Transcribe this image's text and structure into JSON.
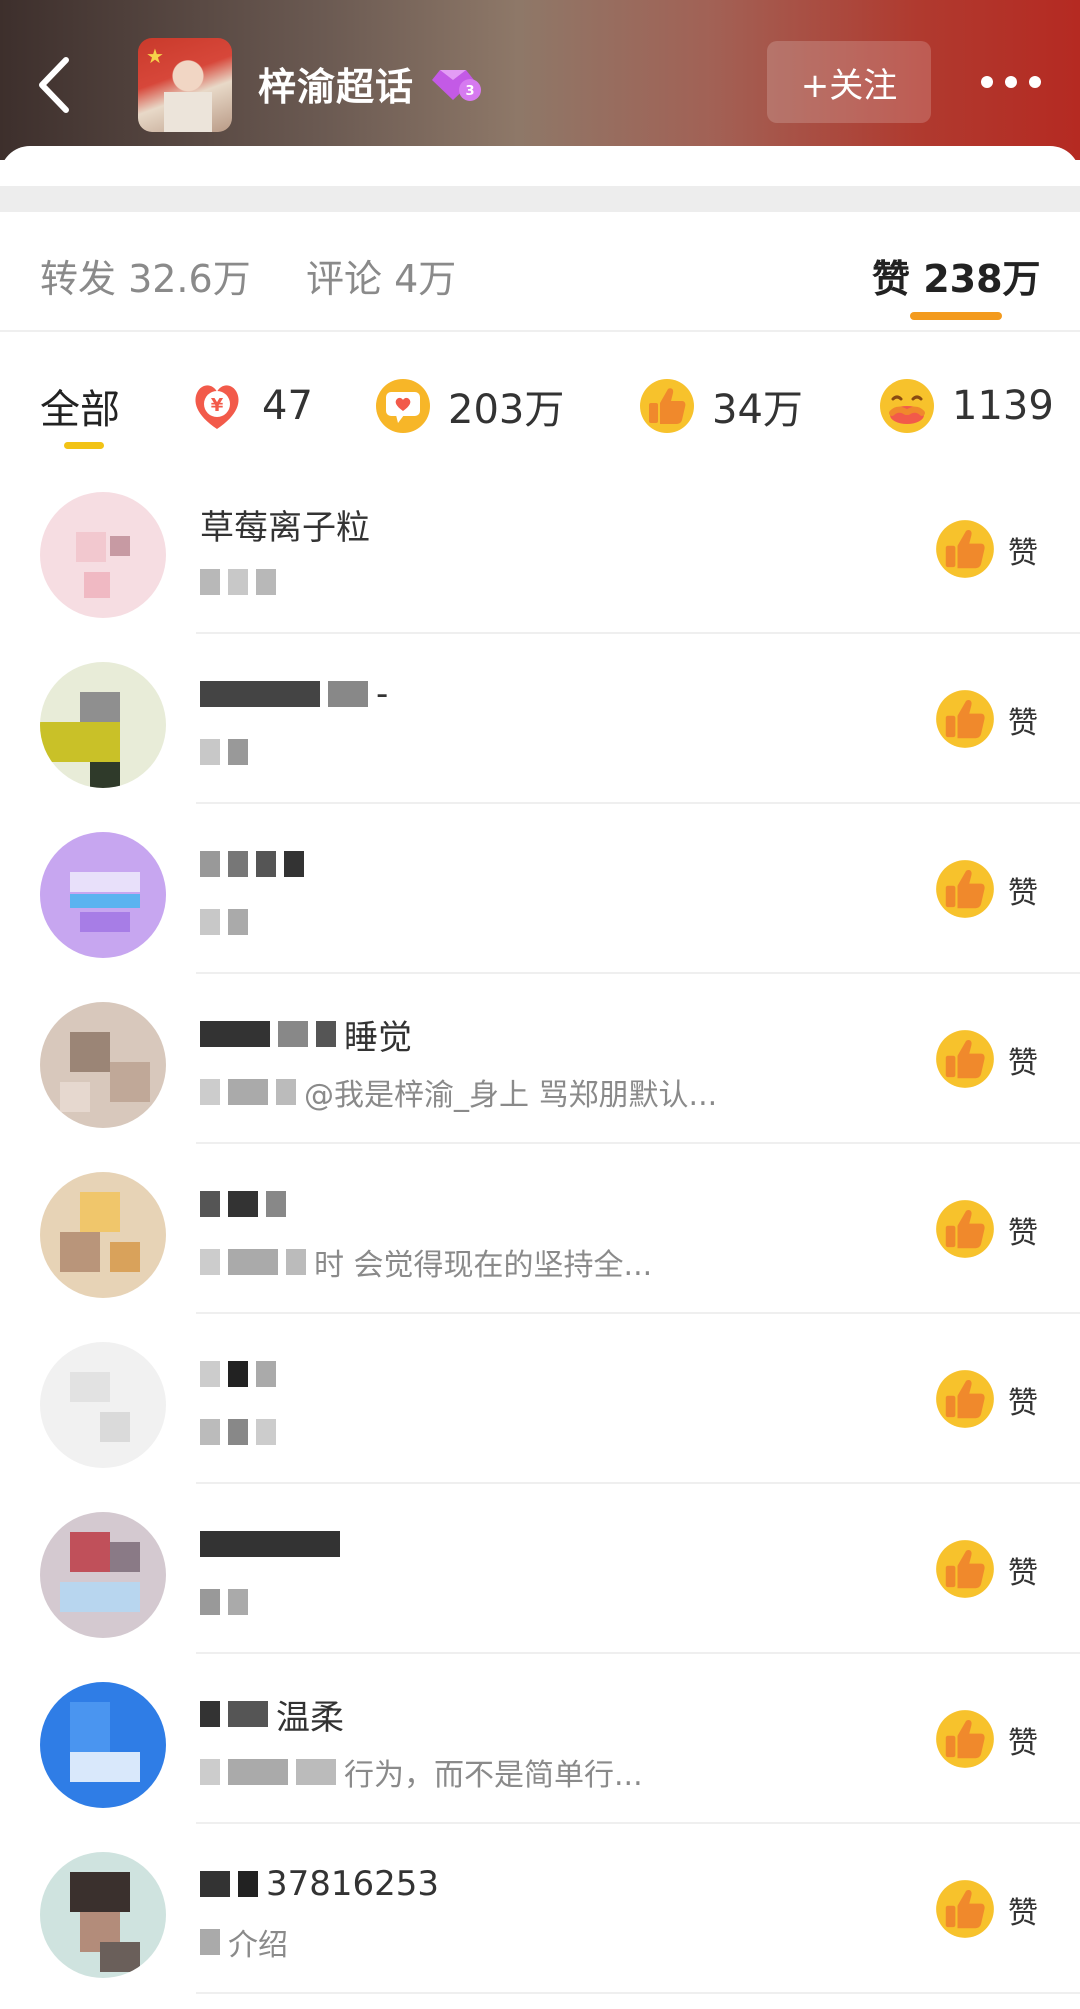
{
  "header": {
    "title": "梓渝超话",
    "follow_label": "+关注",
    "colors": {
      "follow_bg": "#ffffff2e",
      "gradient_end": "#b52a22"
    }
  },
  "stats": {
    "repost": "转发 32.6万",
    "comment": "评论 4万",
    "like": "赞 238万",
    "accent": "#f39a1d"
  },
  "filters": {
    "all": "全部",
    "reward_icon": "reward-yen-icon",
    "reward_count": "47",
    "heart_icon": "heart-bubble-icon",
    "heart_count": "203万",
    "thumb_icon": "thumbs-up-icon",
    "thumb_count": "34万",
    "hug_icon": "hug-emoji-icon",
    "hug_count": "1139"
  },
  "like_label": "赞",
  "users": [
    {
      "name": "草莓离子粒",
      "desc": ""
    },
    {
      "name": "-",
      "desc": ""
    },
    {
      "name": "",
      "desc": ""
    },
    {
      "name": "睡觉",
      "desc": "@我是梓渝_身上 骂郑朋默认..."
    },
    {
      "name": "",
      "desc": "时 会觉得现在的坚持全..."
    },
    {
      "name": "",
      "desc": ""
    },
    {
      "name": "",
      "desc": ""
    },
    {
      "name": "温柔",
      "desc": "行为，而不是简单行..."
    },
    {
      "name": "37816253",
      "desc": "介绍"
    }
  ]
}
